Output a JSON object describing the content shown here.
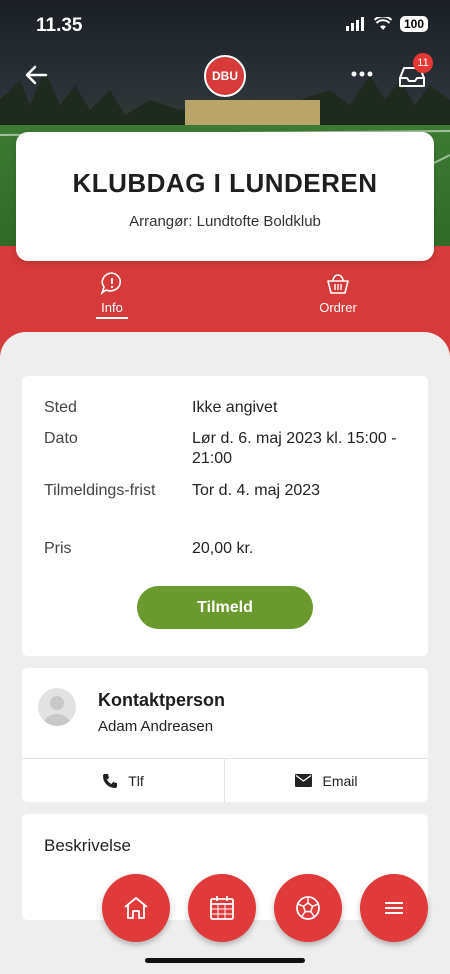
{
  "status_bar": {
    "time": "11.35",
    "battery": "100"
  },
  "header": {
    "logo_text": "DBU",
    "inbox_count": "11"
  },
  "event": {
    "title": "KLUBDAG I LUNDEREN",
    "organizer": "Arrangør: Lundtofte Boldklub"
  },
  "tabs": [
    {
      "label": "Info",
      "icon": "info-bubble-icon",
      "active": true
    },
    {
      "label": "Ordrer",
      "icon": "basket-icon",
      "active": false
    }
  ],
  "details": [
    {
      "key": "Sted",
      "value": "Ikke angivet"
    },
    {
      "key": "Dato",
      "value": "Lør d. 6. maj 2023 kl. 15:00 - 21:00"
    },
    {
      "key": "Tilmeldings-frist",
      "value": "Tor d. 4. maj 2023"
    },
    {
      "key": "Pris",
      "value": "20,00 kr."
    }
  ],
  "signup_label": "Tilmeld",
  "contact": {
    "title": "Kontaktperson",
    "name": "Adam Andreasen",
    "phone_label": "Tlf",
    "email_label": "Email"
  },
  "description": {
    "heading": "Beskrivelse"
  },
  "nav": [
    {
      "icon": "home-icon"
    },
    {
      "icon": "calendar-icon"
    },
    {
      "icon": "football-icon"
    },
    {
      "icon": "menu-icon"
    }
  ],
  "colors": {
    "accent_red": "#d63a3a",
    "button_green": "#6a9a2e"
  }
}
